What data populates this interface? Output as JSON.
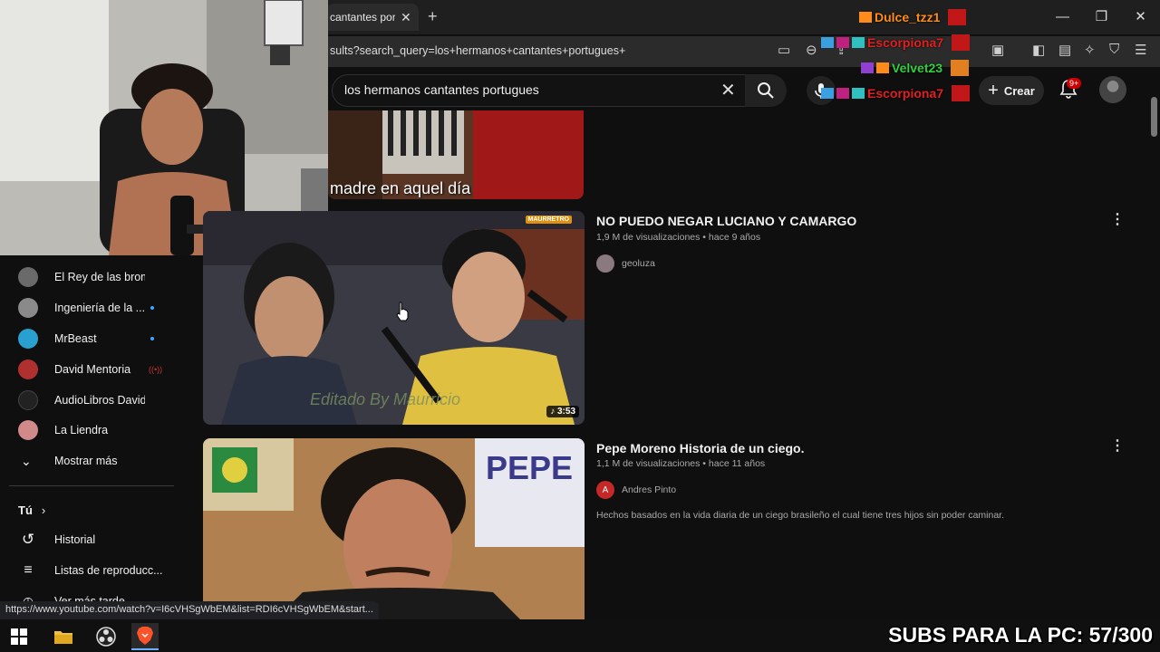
{
  "browser": {
    "tab_title": "cantantes portug",
    "tab_close": "✕",
    "new_tab": "+",
    "url": "sults?search_query=los+hermanos+cantantes+portugues+",
    "window_controls": [
      "—",
      "❐",
      "✕"
    ]
  },
  "youtube": {
    "search_value": "los hermanos cantantes portugues",
    "create_label": "Crear",
    "notification_badge": "9+"
  },
  "overlays": {
    "users": [
      {
        "name": "Dulce_tzz1",
        "color": "#ff8c1a"
      },
      {
        "name": "Escorpiona7",
        "color": "#e02020"
      },
      {
        "name": "Velvet23",
        "color": "#30d040"
      },
      {
        "name": "Escorpiona7",
        "color": "#e02020"
      }
    ],
    "subs_banner": "SUBS PARA LA PC: 57/300"
  },
  "sidebar": {
    "subscriptions": [
      {
        "label": "El Rey de las bromas",
        "dot": false,
        "color": "#6a6a6a"
      },
      {
        "label": "Ingeniería de la ...",
        "dot": true,
        "color": "#8a8a8a"
      },
      {
        "label": "MrBeast",
        "dot": true,
        "color": "#2aa0d0"
      },
      {
        "label": "David Mentoria",
        "dot": false,
        "live": true,
        "color": "#b03030"
      },
      {
        "label": "AudioLibros David ...",
        "dot": false,
        "color": "#222222"
      },
      {
        "label": "La Liendra",
        "dot": false,
        "color": "#d08a8a"
      }
    ],
    "show_more": "Mostrar más",
    "you_label": "Tú",
    "history": "Historial",
    "playlists": "Listas de reproducc...",
    "watch_later": "Ver más tarde"
  },
  "videos": [
    {
      "thumb_caption": "madre en aquel día"
    },
    {
      "title": "NO PUEDO NEGAR LUCIANO Y CAMARGO",
      "meta": "1,9 M de visualizaciones • hace 9 años",
      "channel": "geoluza",
      "duration": "3:53",
      "thumb_tag": "MAURRETRO",
      "watermark": "Editado By Maurricio"
    },
    {
      "title": "Pepe Moreno Historia de un ciego.",
      "meta": "1,1 M de visualizaciones • hace 11 años",
      "channel": "Andres Pinto",
      "channel_initial": "A",
      "description": "Hechos basados en la vida diaria de un ciego brasileño el cual tiene tres hijos sin poder caminar.",
      "thumb_sign": "PEPE"
    }
  ],
  "status_url": "https://www.youtube.com/watch?v=I6cVHSgWbEM&list=RDI6cVHSgWbEM&start...",
  "colors": {
    "bg": "#0f0f0f",
    "accent_red": "#cc0000",
    "text_secondary": "#aaaaaa"
  }
}
